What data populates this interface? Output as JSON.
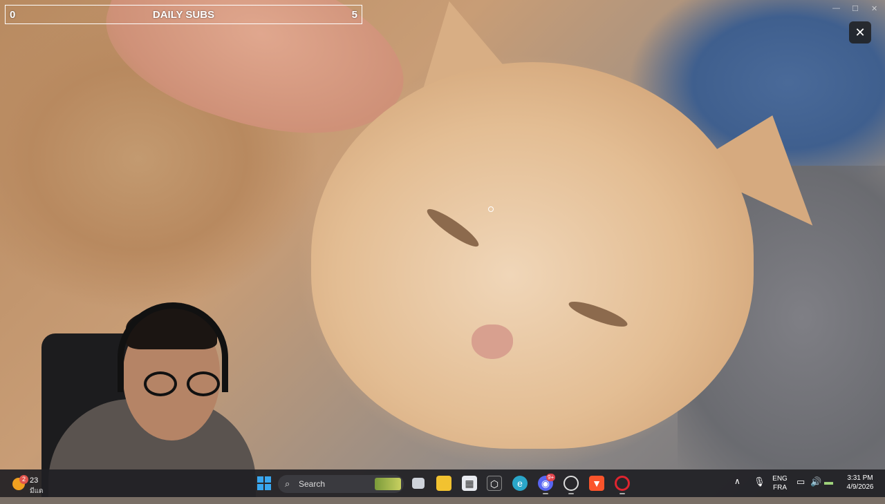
{
  "overlay": {
    "subs_left": "0",
    "subs_title": "DAILY SUBS",
    "subs_right": "5"
  },
  "close_glyph": "✕",
  "taskbar": {
    "weather": {
      "badge": "2",
      "temp": "23",
      "cond": "มีแด"
    },
    "search_label": "Search",
    "language": {
      "line1": "ENG",
      "line2": "FRA"
    },
    "clock": {
      "time": "3:31 PM",
      "date": "4/9/2026"
    },
    "discord_badge": "9+",
    "apps": [
      "task-view-icon",
      "file-explorer-icon",
      "store-icon",
      "app-icon",
      "edge-icon",
      "discord-icon",
      "app-clock-icon",
      "brave-icon",
      "opera-icon"
    ]
  },
  "colors": {
    "taskbar_bg": "#202024",
    "windows_blue": "#39a7f0",
    "edge": "#2aa6c9",
    "discord": "#5865f2",
    "brave": "#fb542b",
    "opera": "#e0242f"
  }
}
